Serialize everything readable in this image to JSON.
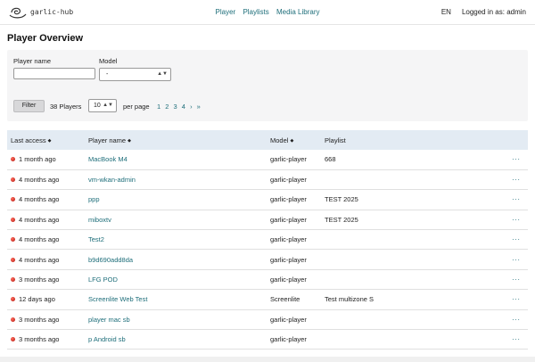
{
  "header": {
    "brand": "garlic-hub",
    "nav": [
      "Player",
      "Playlists",
      "Media Library"
    ],
    "language": "EN",
    "logged_in": "Logged in as: admin"
  },
  "page": {
    "title": "Player Overview"
  },
  "filter": {
    "name_label": "Player name",
    "name_value": "",
    "model_label": "Model",
    "model_value": "-",
    "button": "Filter",
    "count": "38 Players",
    "per_page_value": "10",
    "per_page_label": "per page",
    "pages": [
      "1",
      "2",
      "3",
      "4",
      "›",
      "»"
    ]
  },
  "table": {
    "headers": [
      "Last access",
      "Player name",
      "Model",
      "Playlist"
    ],
    "rows": [
      {
        "access": "1 month ago",
        "name": "MacBook M4",
        "model": "garlic-player",
        "playlist": "668"
      },
      {
        "access": "4 months ago",
        "name": "vm-wkan-admin",
        "model": "garlic-player",
        "playlist": ""
      },
      {
        "access": "4 months ago",
        "name": "ppp",
        "model": "garlic-player",
        "playlist": "TEST 2025"
      },
      {
        "access": "4 months ago",
        "name": "miboxtv",
        "model": "garlic-player",
        "playlist": "TEST 2025"
      },
      {
        "access": "4 months ago",
        "name": "Test2",
        "model": "garlic-player",
        "playlist": ""
      },
      {
        "access": "4 months ago",
        "name": "b9d690add8da",
        "model": "garlic-player",
        "playlist": ""
      },
      {
        "access": "3 months ago",
        "name": "LFG POD",
        "model": "garlic-player",
        "playlist": ""
      },
      {
        "access": "12 days ago",
        "name": "Screenlite Web Test",
        "model": "Screenlite",
        "playlist": "Test multizone S"
      },
      {
        "access": "3 months ago",
        "name": "player mac sb",
        "model": "garlic-player",
        "playlist": ""
      },
      {
        "access": "3 months ago",
        "name": "p Android sb",
        "model": "garlic-player",
        "playlist": ""
      }
    ],
    "menu_glyph": "···"
  },
  "colors": {
    "link": "#1e6e7a",
    "header_bg": "#e3ebf3",
    "status": "#d0241a"
  },
  "icons": {
    "brand": "garlic-logo-icon",
    "status": "status-dot-icon",
    "sort": "sort-caret-icon",
    "menu": "more-menu-icon"
  }
}
